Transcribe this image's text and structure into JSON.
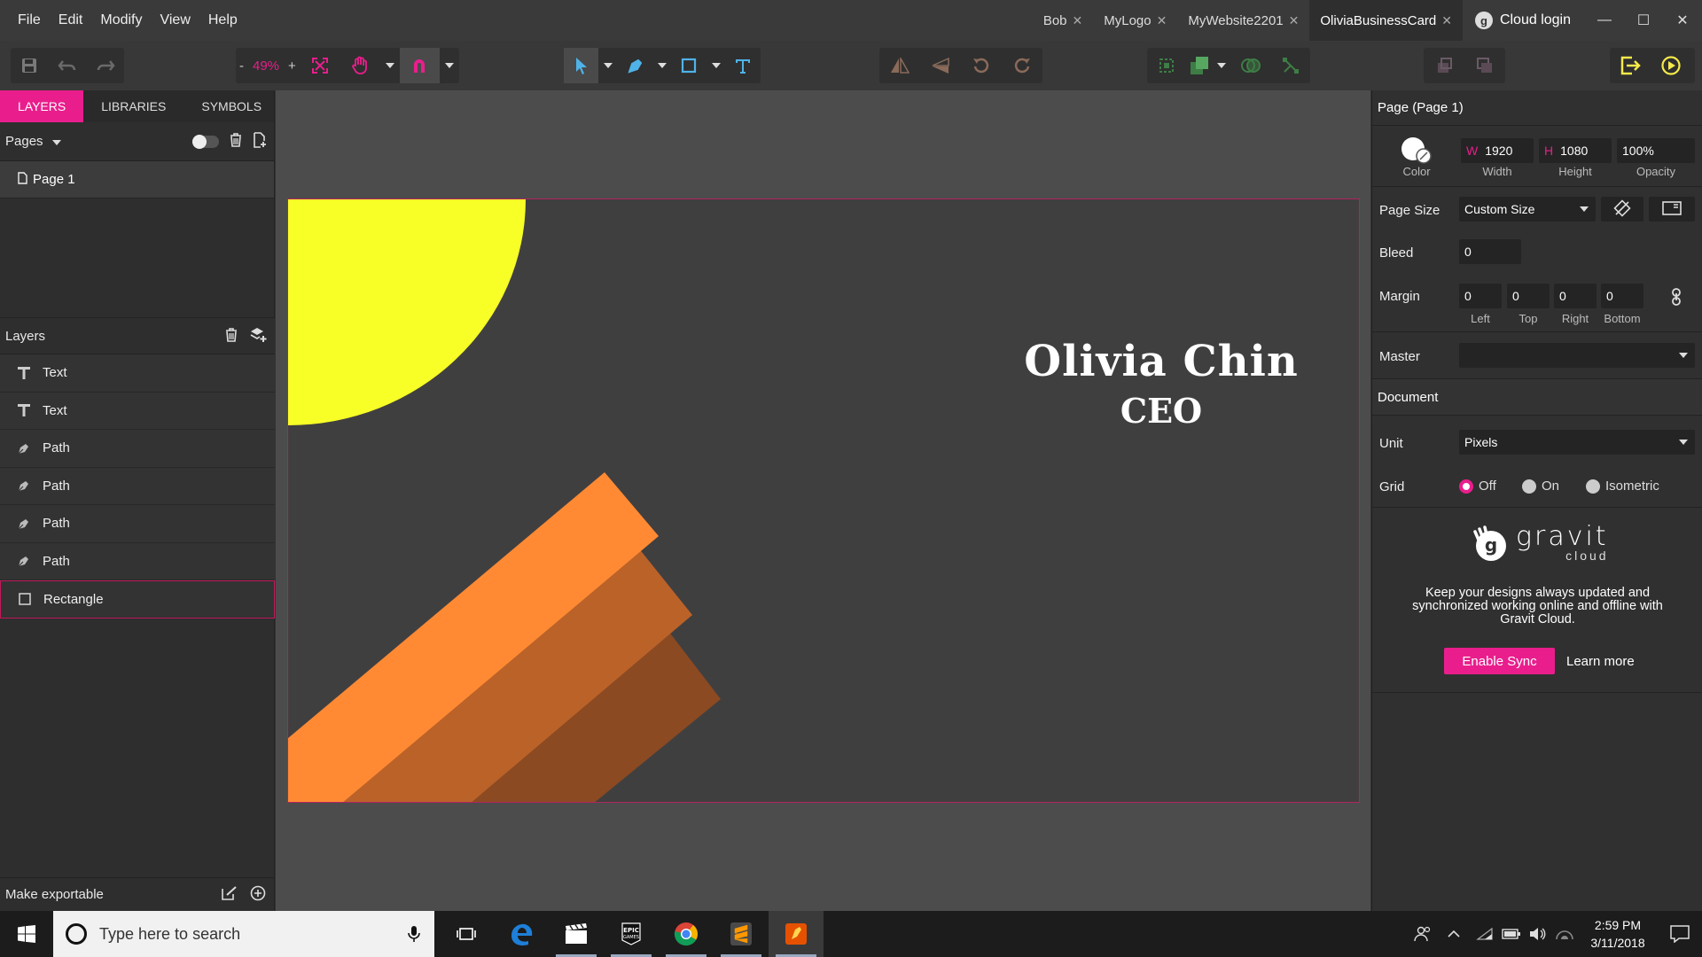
{
  "menu": [
    "File",
    "Edit",
    "Modify",
    "View",
    "Help"
  ],
  "tabs": [
    {
      "label": "Bob",
      "active": false
    },
    {
      "label": "MyLogo",
      "active": false
    },
    {
      "label": "MyWebsite2201",
      "active": false
    },
    {
      "label": "OliviaBusinessCard",
      "active": true
    }
  ],
  "cloud_login": "Cloud login",
  "toolbar": {
    "zoom": "49%",
    "zoom_minus": "-",
    "zoom_plus": "+"
  },
  "left": {
    "tabs": [
      "LAYERS",
      "LIBRARIES",
      "SYMBOLS"
    ],
    "pages_label": "Pages",
    "pages": [
      "Page 1"
    ],
    "layers_label": "Layers",
    "layers": [
      {
        "type": "text",
        "label": "Text"
      },
      {
        "type": "path",
        "label": "Text"
      },
      {
        "type": "path",
        "label": "Path"
      },
      {
        "type": "path",
        "label": "Path"
      },
      {
        "type": "path",
        "label": "Path"
      },
      {
        "type": "path",
        "label": "Path"
      },
      {
        "type": "rect",
        "label": "Rectangle"
      }
    ],
    "export_label": "Make exportable"
  },
  "artboard": {
    "name": "Olivia Chin",
    "title": "CEO"
  },
  "right": {
    "header": "Page (Page 1)",
    "color_label": "Color",
    "width_prefix": "W",
    "width": "1920",
    "width_label": "Width",
    "height_prefix": "H",
    "height": "1080",
    "height_label": "Height",
    "opacity": "100%",
    "opacity_label": "Opacity",
    "page_size_label": "Page Size",
    "page_size": "Custom Size",
    "bleed_label": "Bleed",
    "bleed": "0",
    "margin_label": "Margin",
    "margin": {
      "left": "0",
      "top": "0",
      "right": "0",
      "bottom": "0"
    },
    "margin_sub": {
      "left": "Left",
      "top": "Top",
      "right": "Right",
      "bottom": "Bottom"
    },
    "master_label": "Master",
    "master": "",
    "document_header": "Document",
    "unit_label": "Unit",
    "unit": "Pixels",
    "grid_label": "Grid",
    "grid_options": [
      {
        "label": "Off",
        "selected": true
      },
      {
        "label": "On",
        "selected": false
      },
      {
        "label": "Isometric",
        "selected": false
      }
    ],
    "gravit_word": "gravit",
    "gravit_sub": "cloud",
    "promo": "Keep your designs always updated and synchronized working online and offline with Gravit Cloud.",
    "enable_sync": "Enable Sync",
    "learn_more": "Learn more"
  },
  "taskbar": {
    "search_placeholder": "Type here to search",
    "time": "2:59 PM",
    "date": "3/11/2018"
  },
  "colors": {
    "accent": "#e91e8c",
    "canvas": "#403f40",
    "sun": "#f7ff26",
    "stripe1": "#ff8a33",
    "stripe2": "#bb6229",
    "stripe3": "#8b4a22"
  }
}
